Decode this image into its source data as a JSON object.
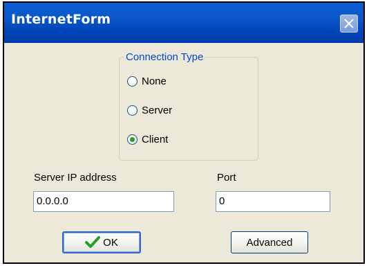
{
  "window": {
    "title": "InternetForm"
  },
  "connection_type": {
    "label": "Connection Type",
    "options": [
      {
        "label": "None",
        "selected": false
      },
      {
        "label": "Server",
        "selected": false
      },
      {
        "label": "Client",
        "selected": true
      }
    ]
  },
  "server_ip": {
    "label": "Server IP address",
    "value": "0.0.0.0"
  },
  "port": {
    "label": "Port",
    "value": "0"
  },
  "buttons": {
    "ok_label": "OK",
    "advanced_label": "Advanced"
  },
  "colors": {
    "titlebar": "#0a58ca",
    "groupbox_label": "#0046d5",
    "radio_selected_dot": "#21a121",
    "ok_check": "#2a9d2a",
    "window_bg": "#ece9d8"
  },
  "icons": {
    "close": "close-icon",
    "ok": "checkmark-icon"
  }
}
